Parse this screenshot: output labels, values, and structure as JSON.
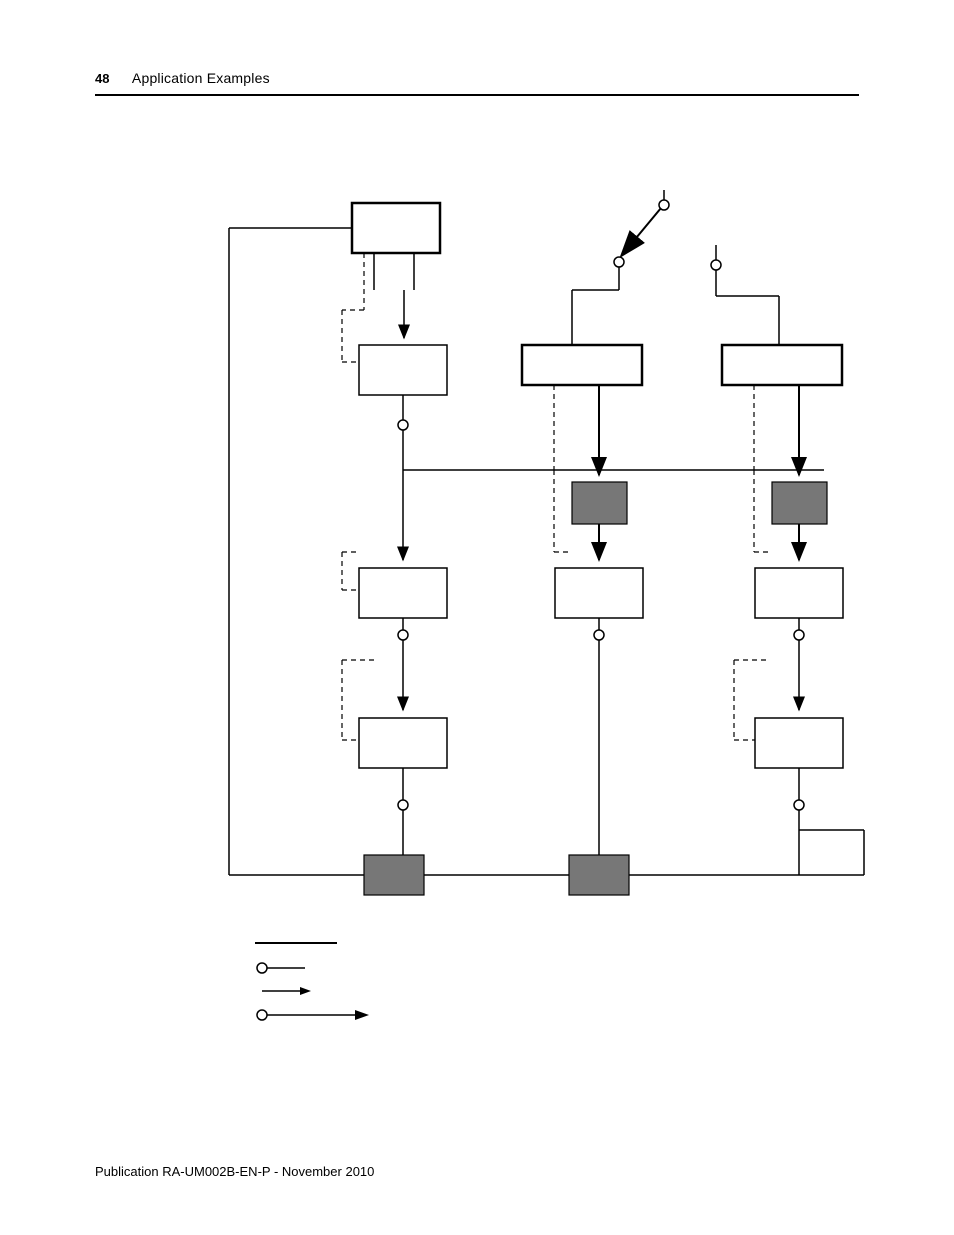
{
  "header": {
    "page_number": "48",
    "section_title": "Application Examples"
  },
  "footer": {
    "publication": "Publication RA-UM002B-EN-P - November 2010"
  },
  "diagram": {
    "type": "block-flowchart",
    "legend": [
      "solid-line",
      "hollow-dot-line",
      "arrow-line",
      "hollow-dot-arrow-line"
    ]
  }
}
